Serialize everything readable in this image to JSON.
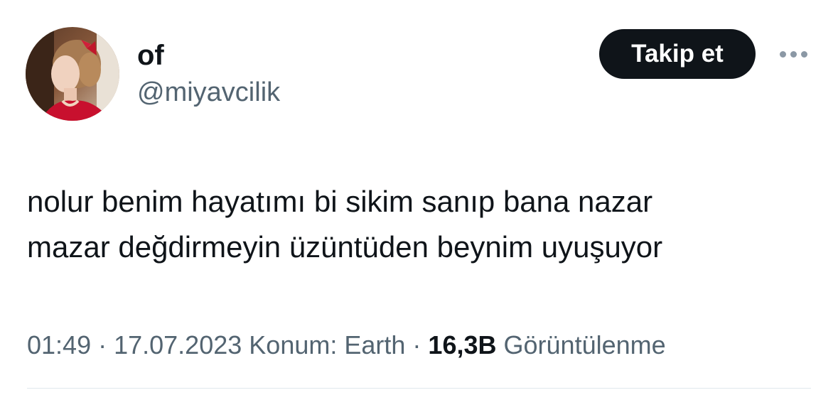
{
  "author": {
    "display_name": "of",
    "handle": "@miyavcilik"
  },
  "follow_button": {
    "label": "Takip et"
  },
  "tweet": {
    "lines": [
      "nolur benim hayatımı bi sikim sanıp bana nazar",
      "mazar değdirmeyin üzüntüden beynim uyuşuyor"
    ]
  },
  "meta": {
    "time": "01:49",
    "separator": " · ",
    "date": "17.07.2023",
    "location": "Konum: Earth",
    "views_count": "16,3B",
    "views_label": "Görüntülenme"
  },
  "icons": {
    "more": "more-horizontal-icon"
  },
  "colors": {
    "text_primary": "#0f1419",
    "text_secondary": "#536471",
    "button_bg": "#0f1419",
    "button_text": "#ffffff"
  }
}
